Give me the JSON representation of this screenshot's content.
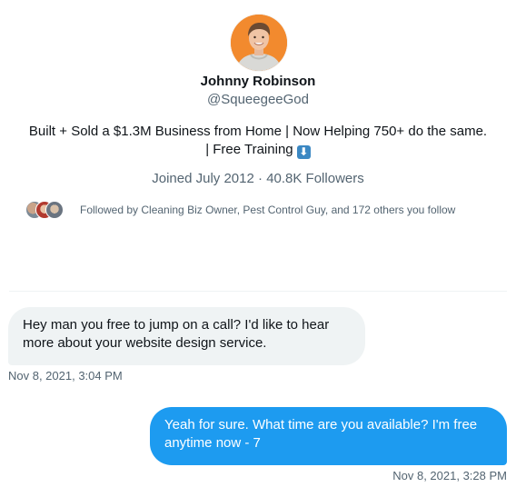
{
  "profile": {
    "display_name": "Johnny Robinson",
    "handle": "@SqueegeeGod",
    "bio_line1": "Built + Sold a  $1.3M Business from Home | Now Helping 750+ do the same.",
    "bio_line2_prefix": "| Free Training ",
    "bio_emoji": "⬇",
    "bio_emoji_icon": "down-arrow-emoji-icon",
    "joined": "Joined July 2012",
    "separator": " · ",
    "followers": "40.8K Followers",
    "followed_by": "Followed by Cleaning Biz Owner, Pest Control Guy, and 172 others you follow",
    "avatar_color": "#f28a2e"
  },
  "messages": [
    {
      "direction": "incoming",
      "text": "Hey man you free to jump on a call? I'd like to hear more about your website design service.",
      "timestamp": "Nov 8, 2021, 3:04 PM",
      "bubble_color": "#eff3f4"
    },
    {
      "direction": "outgoing",
      "text": "Yeah for sure. What time are you available? I'm free anytime now - 7",
      "timestamp": "Nov 8, 2021, 3:28 PM",
      "bubble_color": "#1d9bf0"
    }
  ],
  "colors": {
    "accent": "#1d9bf0",
    "secondary_text": "#536471",
    "primary_text": "#0f1419"
  }
}
